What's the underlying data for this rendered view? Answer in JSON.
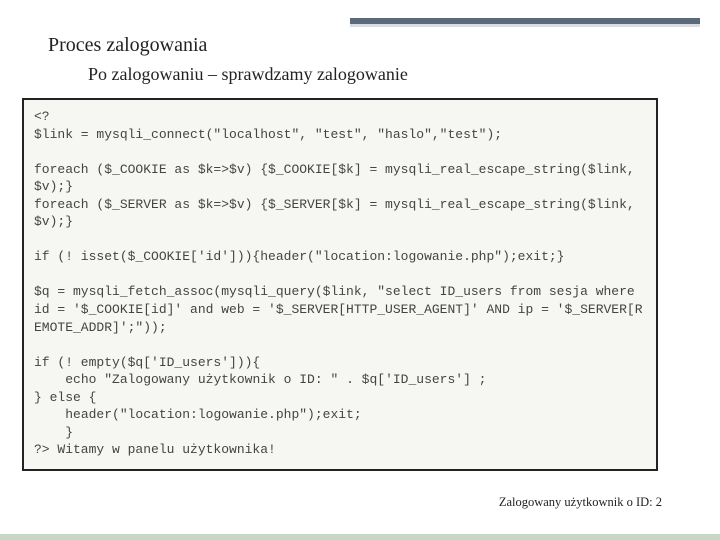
{
  "title": "Proces zalogowania",
  "subtitle": "Po zalogowaniu – sprawdzamy zalogowanie",
  "code": "<?\n$link = mysqli_connect(\"localhost\", \"test\", \"haslo\",\"test\");\n\nforeach ($_COOKIE as $k=>$v) {$_COOKIE[$k] = mysqli_real_escape_string($link, $v);}\nforeach ($_SERVER as $k=>$v) {$_SERVER[$k] = mysqli_real_escape_string($link, $v);}\n\nif (! isset($_COOKIE['id'])){header(\"location:logowanie.php\");exit;}\n\n$q = mysqli_fetch_assoc(mysqli_query($link, \"select ID_users from sesja where id = '$_COOKIE[id]' and web = '$_SERVER[HTTP_USER_AGENT]' AND ip = '$_SERVER[REMOTE_ADDR]';\"));\n\nif (! empty($q['ID_users'])){\n    echo \"Zalogowany użytkownik o ID: \" . $q['ID_users'] ;\n} else {\n    header(\"location:logowanie.php\");exit;\n    }\n?> Witamy w panelu użytkownika!",
  "footer": "Zalogowany użytkownik o ID: 2"
}
